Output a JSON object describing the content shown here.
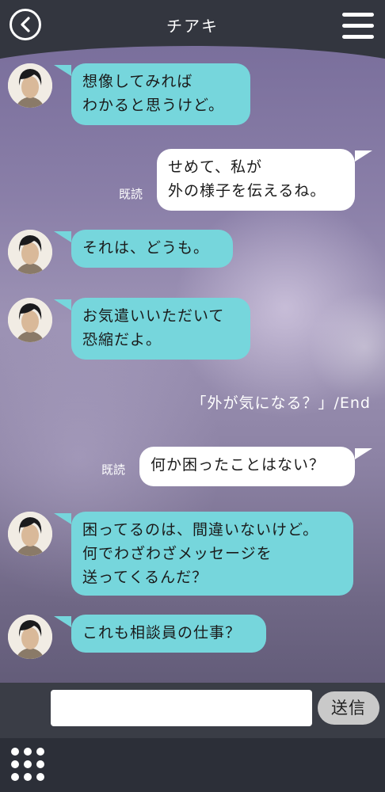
{
  "header": {
    "title": "チアキ",
    "back_icon": "chevron-left-icon",
    "menu_icon": "hamburger-menu-icon"
  },
  "messages": [
    {
      "side": "left",
      "text": "想像してみれば\nわかると思うけど。"
    },
    {
      "side": "right",
      "text": "せめて、私が\n外の様子を伝えるね。",
      "read": "既読"
    },
    {
      "side": "left",
      "text": "それは、どうも。"
    },
    {
      "side": "left",
      "text": "お気遣いいただいて\n恐縮だよ。"
    },
    {
      "side": "right",
      "text": "何か困ったことはない？",
      "read": "既読"
    },
    {
      "side": "left",
      "text": "困ってるのは、間違いないけど。\n何でわざわざメッセージを\n送ってくるんだ？"
    },
    {
      "side": "left",
      "text": "これも相談員の仕事？"
    }
  ],
  "system_line": "「外が気になる？」/End",
  "input": {
    "value": "",
    "placeholder": "",
    "send_label": "送信"
  },
  "colors": {
    "left_bubble": "#76d6dc",
    "right_bubble": "#ffffff",
    "header_bg": "#33363f"
  },
  "bottom_icon": "grid-menu-icon"
}
